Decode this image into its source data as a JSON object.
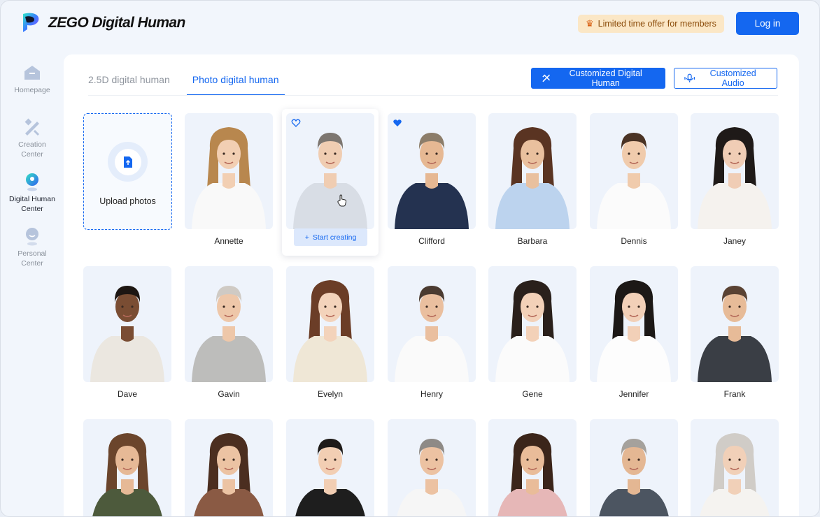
{
  "app": {
    "title": "ZEGO Digital Human"
  },
  "header": {
    "offer_label": "Limited time offer for members",
    "login_label": "Log in"
  },
  "sidebar": {
    "items": [
      {
        "label": "Homepage",
        "icon": "home-icon",
        "active": false
      },
      {
        "label": "Creation Center",
        "icon": "creation-icon",
        "active": false
      },
      {
        "label": "Digital Human Center",
        "icon": "digital-human-icon",
        "active": true
      },
      {
        "label": "Personal Center",
        "icon": "user-icon",
        "active": false
      }
    ]
  },
  "tabs": [
    {
      "label": "2.5D digital human",
      "active": false
    },
    {
      "label": "Photo digital human",
      "active": true
    }
  ],
  "actions": {
    "customized_dh_label": "Customized Digital Human",
    "customized_audio_label": "Customized Audio"
  },
  "upload": {
    "label": "Upload photos"
  },
  "hover": {
    "start_label": "Start creating"
  },
  "people": [
    {
      "name": "Annette",
      "skin": "#f2cfb3",
      "hair": "#b8874e",
      "outfit": "#f9f9f9",
      "gender": "f"
    },
    {
      "name": "",
      "skin": "#f0cdb2",
      "hair": "#7d7670",
      "outfit": "#d8dde5",
      "gender": "m",
      "favorite": false,
      "hovered": true
    },
    {
      "name": "Clifford",
      "skin": "#e6b893",
      "hair": "#8c7d6a",
      "outfit": "#243250",
      "gender": "m",
      "favorite": true
    },
    {
      "name": "Barbara",
      "skin": "#e9c09e",
      "hair": "#5a3422",
      "outfit": "#bcd3ee",
      "gender": "f"
    },
    {
      "name": "Dennis",
      "skin": "#f0cbac",
      "hair": "#4a3325",
      "outfit": "#fbfbfb",
      "gender": "m"
    },
    {
      "name": "Janey",
      "skin": "#f0cdb5",
      "hair": "#1f1a18",
      "outfit": "#f5f2ee",
      "gender": "f"
    },
    {
      "name": "Dave",
      "skin": "#7a4d33",
      "hair": "#1d1612",
      "outfit": "#ebe7e0",
      "gender": "m"
    },
    {
      "name": "Gavin",
      "skin": "#eec7a9",
      "hair": "#cfcac4",
      "outfit": "#bdbdbb",
      "gender": "m"
    },
    {
      "name": "Evelyn",
      "skin": "#f3d3bb",
      "hair": "#6b3d27",
      "outfit": "#efe7d6",
      "gender": "f"
    },
    {
      "name": "Henry",
      "skin": "#eabf9f",
      "hair": "#4b3b31",
      "outfit": "#fafafa",
      "gender": "m"
    },
    {
      "name": "Gene",
      "skin": "#f3d1b8",
      "hair": "#2a201b",
      "outfit": "#fbfbfb",
      "gender": "f"
    },
    {
      "name": "Jennifer",
      "skin": "#f2d0b8",
      "hair": "#1c1816",
      "outfit": "#fdfdfd",
      "gender": "f"
    },
    {
      "name": "Frank",
      "skin": "#e7bb98",
      "hair": "#5a4233",
      "outfit": "#3a3e45",
      "gender": "m"
    },
    {
      "name": "",
      "skin": "#e6b996",
      "hair": "#6b452c",
      "outfit": "#4d5a3c",
      "gender": "f"
    },
    {
      "name": "",
      "skin": "#ecc3a3",
      "hair": "#4b2e20",
      "outfit": "#8a5a44",
      "gender": "f"
    },
    {
      "name": "",
      "skin": "#f2ceb3",
      "hair": "#1f1b19",
      "outfit": "#1e1e1e",
      "gender": "m"
    },
    {
      "name": "",
      "skin": "#ecc2a2",
      "hair": "#8e8a86",
      "outfit": "#f6f6f6",
      "gender": "m"
    },
    {
      "name": "",
      "skin": "#e9bc99",
      "hair": "#3b251a",
      "outfit": "#e6b7b7",
      "gender": "f"
    },
    {
      "name": "",
      "skin": "#e4b793",
      "hair": "#a5a19c",
      "outfit": "#4c5561",
      "gender": "m"
    },
    {
      "name": "",
      "skin": "#f1d0b8",
      "hair": "#d0ccc7",
      "outfit": "#f5f3f0",
      "gender": "f"
    }
  ]
}
